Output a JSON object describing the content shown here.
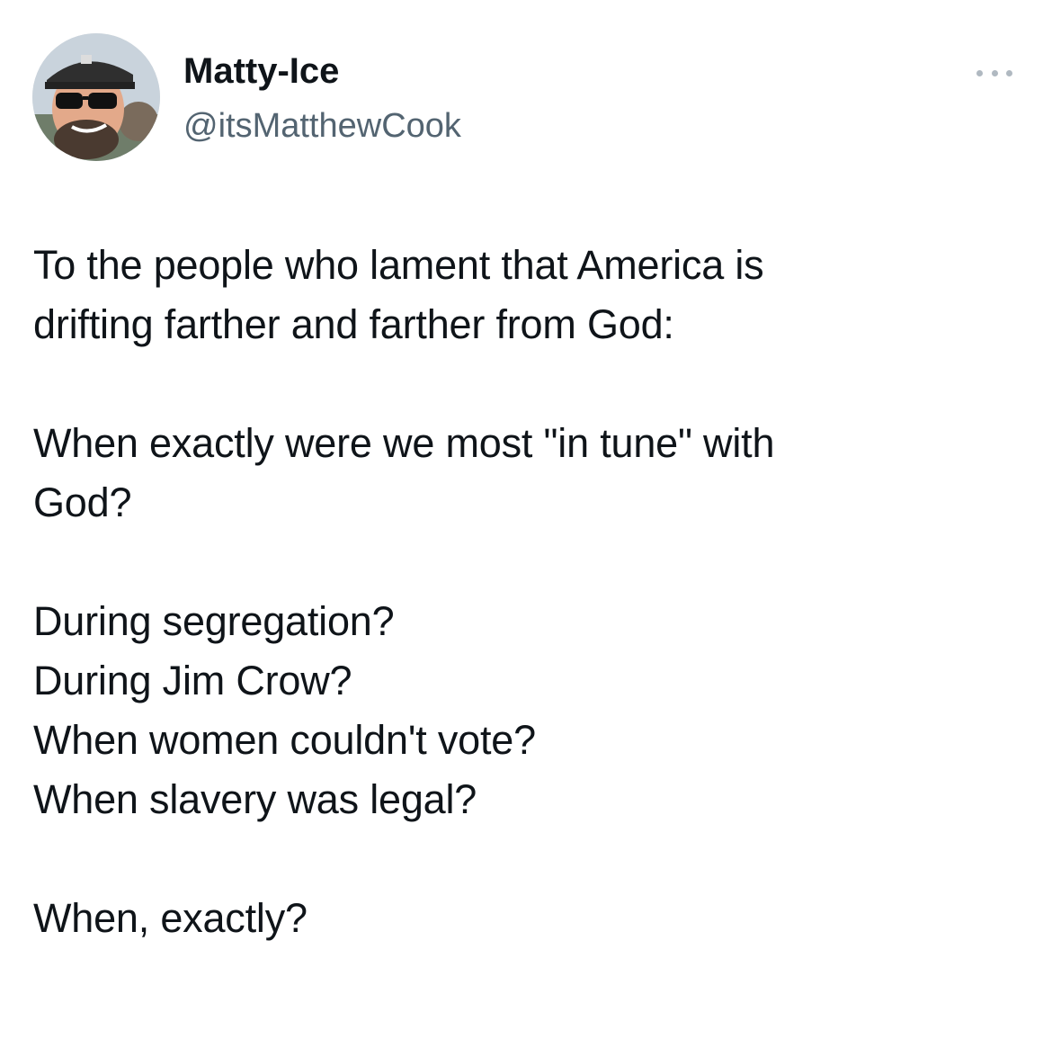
{
  "tweet": {
    "author": {
      "display_name": "Matty-Ice",
      "handle": "@itsMatthewCook",
      "avatar_icon": "profile-photo"
    },
    "more_icon": "ellipsis-icon",
    "paragraphs": [
      [
        "To the people who lament that America is",
        "drifting farther and farther from God:"
      ],
      [
        "When exactly were we most \"in tune\" with",
        "God?"
      ],
      [
        "During segregation?",
        "During Jim Crow?",
        "When women couldn't vote?",
        "When slavery was legal?"
      ],
      [
        "When, exactly?"
      ]
    ]
  }
}
